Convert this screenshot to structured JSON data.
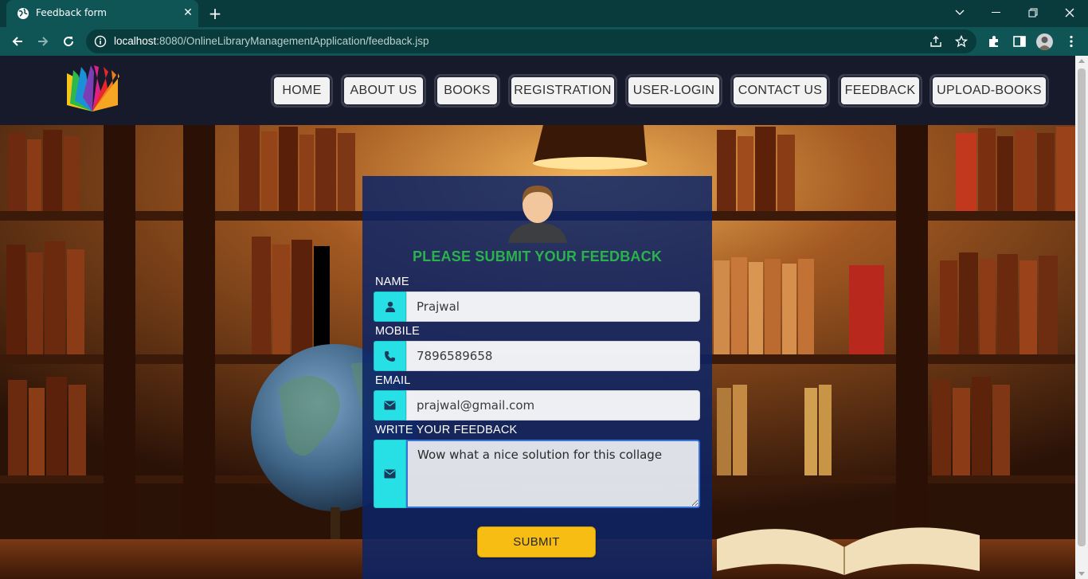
{
  "browser": {
    "tab_title": "Feedback form",
    "url_host": "localhost",
    "url_rest": ":8080/OnlineLibraryManagementApplication/feedback.jsp"
  },
  "nav": {
    "items": [
      "HOME",
      "ABOUT US",
      "BOOKS",
      "REGISTRATION",
      "USER-LOGIN",
      "CONTACT US",
      "FEEDBACK",
      "UPLOAD-BOOKS"
    ]
  },
  "form": {
    "title": "PLEASE SUBMIT YOUR FEEDBACK",
    "name_label": "NAME",
    "name_value": "Prajwal",
    "mobile_label": "MOBILE",
    "mobile_value": "7896589658",
    "email_label": "EMAIL",
    "email_value": "prajwal@gmail.com",
    "feedback_label": "WRITE YOUR FEEDBACK",
    "feedback_value": "Wow what a nice solution for this collage",
    "submit_label": "SUBMIT"
  },
  "colors": {
    "browser_frame": "#0a3b3c",
    "navbar": "#171a2a",
    "form_panel": "#0c2466",
    "title_green": "#2bb24c",
    "icon_cyan": "#27e0e6",
    "submit_yellow": "#f8bd12"
  },
  "icons": {
    "tab_favicon": "globe-icon",
    "name_field": "user-icon",
    "mobile_field": "phone-icon",
    "email_field": "envelope-icon",
    "feedback_field": "envelope-icon"
  }
}
